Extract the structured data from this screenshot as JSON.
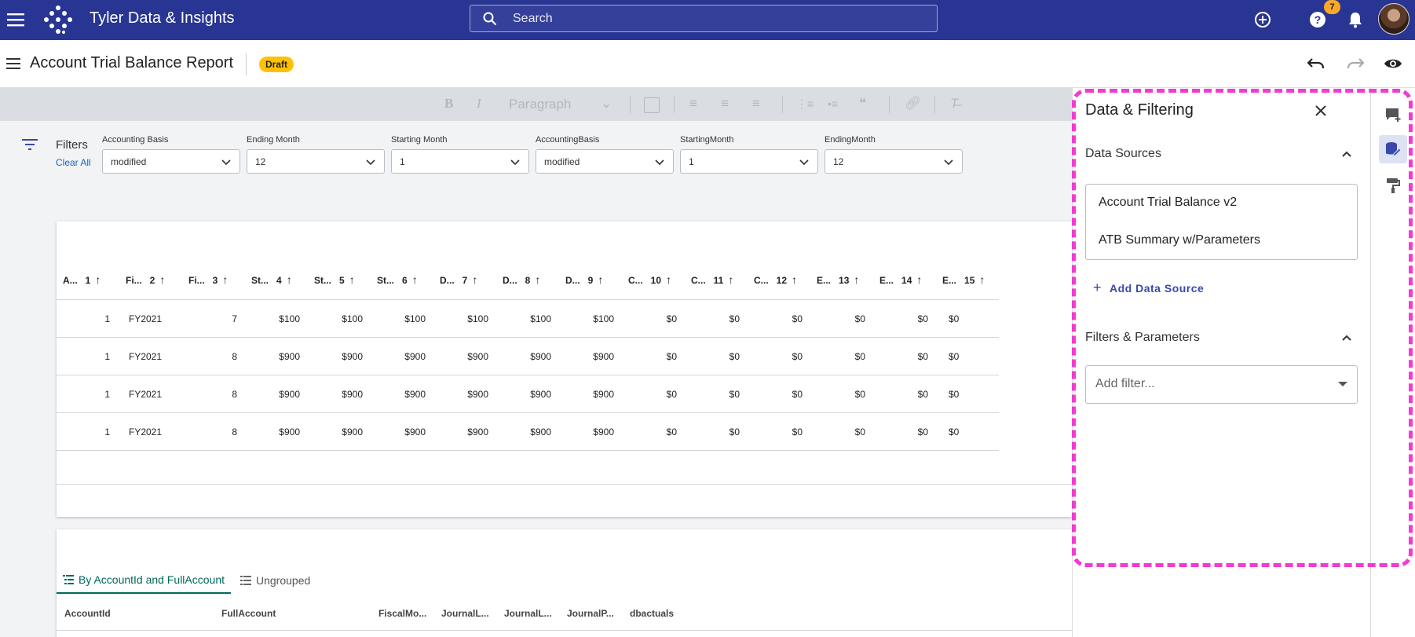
{
  "app": {
    "title": "Tyler Data & Insights",
    "search_placeholder": "Search",
    "help_badge": "7"
  },
  "header": {
    "page_title": "Account Trial Balance Report",
    "status_badge": "Draft"
  },
  "toolbar": {
    "bold": "B",
    "italic": "I",
    "paragraph": "Paragraph"
  },
  "filters": {
    "label": "Filters",
    "clear_all": "Clear All",
    "items": [
      {
        "label": "Accounting Basis",
        "value": "modified"
      },
      {
        "label": "Ending Month",
        "value": "12"
      },
      {
        "label": "Starting Month",
        "value": "1"
      },
      {
        "label": "AccountingBasis",
        "value": "modified"
      },
      {
        "label": "StartingMonth",
        "value": "1"
      },
      {
        "label": "EndingMonth",
        "value": "12"
      }
    ]
  },
  "table": {
    "columns": [
      {
        "abbr": "A...",
        "num": "1"
      },
      {
        "abbr": "Fi...",
        "num": "2"
      },
      {
        "abbr": "Fi...",
        "num": "3"
      },
      {
        "abbr": "St...",
        "num": "4"
      },
      {
        "abbr": "St...",
        "num": "5"
      },
      {
        "abbr": "St...",
        "num": "6"
      },
      {
        "abbr": "D...",
        "num": "7"
      },
      {
        "abbr": "D...",
        "num": "8"
      },
      {
        "abbr": "D...",
        "num": "9"
      },
      {
        "abbr": "C...",
        "num": "10"
      },
      {
        "abbr": "C...",
        "num": "11"
      },
      {
        "abbr": "C...",
        "num": "12"
      },
      {
        "abbr": "E...",
        "num": "13"
      },
      {
        "abbr": "E...",
        "num": "14"
      },
      {
        "abbr": "E...",
        "num": "15"
      }
    ],
    "rows": [
      [
        "1",
        "FY2021",
        "7",
        "$100",
        "$100",
        "$100",
        "$100",
        "$100",
        "$100",
        "$0",
        "$0",
        "$0",
        "$0",
        "$0",
        "$0"
      ],
      [
        "1",
        "FY2021",
        "8",
        "$900",
        "$900",
        "$900",
        "$900",
        "$900",
        "$900",
        "$0",
        "$0",
        "$0",
        "$0",
        "$0",
        "$0"
      ],
      [
        "1",
        "FY2021",
        "8",
        "$900",
        "$900",
        "$900",
        "$900",
        "$900",
        "$900",
        "$0",
        "$0",
        "$0",
        "$0",
        "$0",
        "$0"
      ],
      [
        "1",
        "FY2021",
        "8",
        "$900",
        "$900",
        "$900",
        "$900",
        "$900",
        "$900",
        "$0",
        "$0",
        "$0",
        "$0",
        "$0",
        "$0"
      ]
    ]
  },
  "grouped": {
    "tabs": [
      {
        "label": "By AccountId and FullAccount",
        "active": true
      },
      {
        "label": "Ungrouped",
        "active": false
      }
    ],
    "columns": [
      "AccountId",
      "FullAccount",
      "FiscalMo...",
      "JournalL...",
      "JournalL...",
      "JournalP...",
      "dbactuals"
    ]
  },
  "panel": {
    "title": "Data & Filtering",
    "data_sources_title": "Data Sources",
    "data_sources": [
      "Account Trial Balance v2",
      "ATB Summary w/Parameters"
    ],
    "add_data_source": "Add Data Source",
    "filters_title": "Filters & Parameters",
    "add_filter_placeholder": "Add filter..."
  },
  "colors": {
    "topbar": "#283593",
    "accent": "#3949ab",
    "draft": "#ffc107",
    "highlight": "#f13bd3",
    "tab_active": "#00695c"
  }
}
